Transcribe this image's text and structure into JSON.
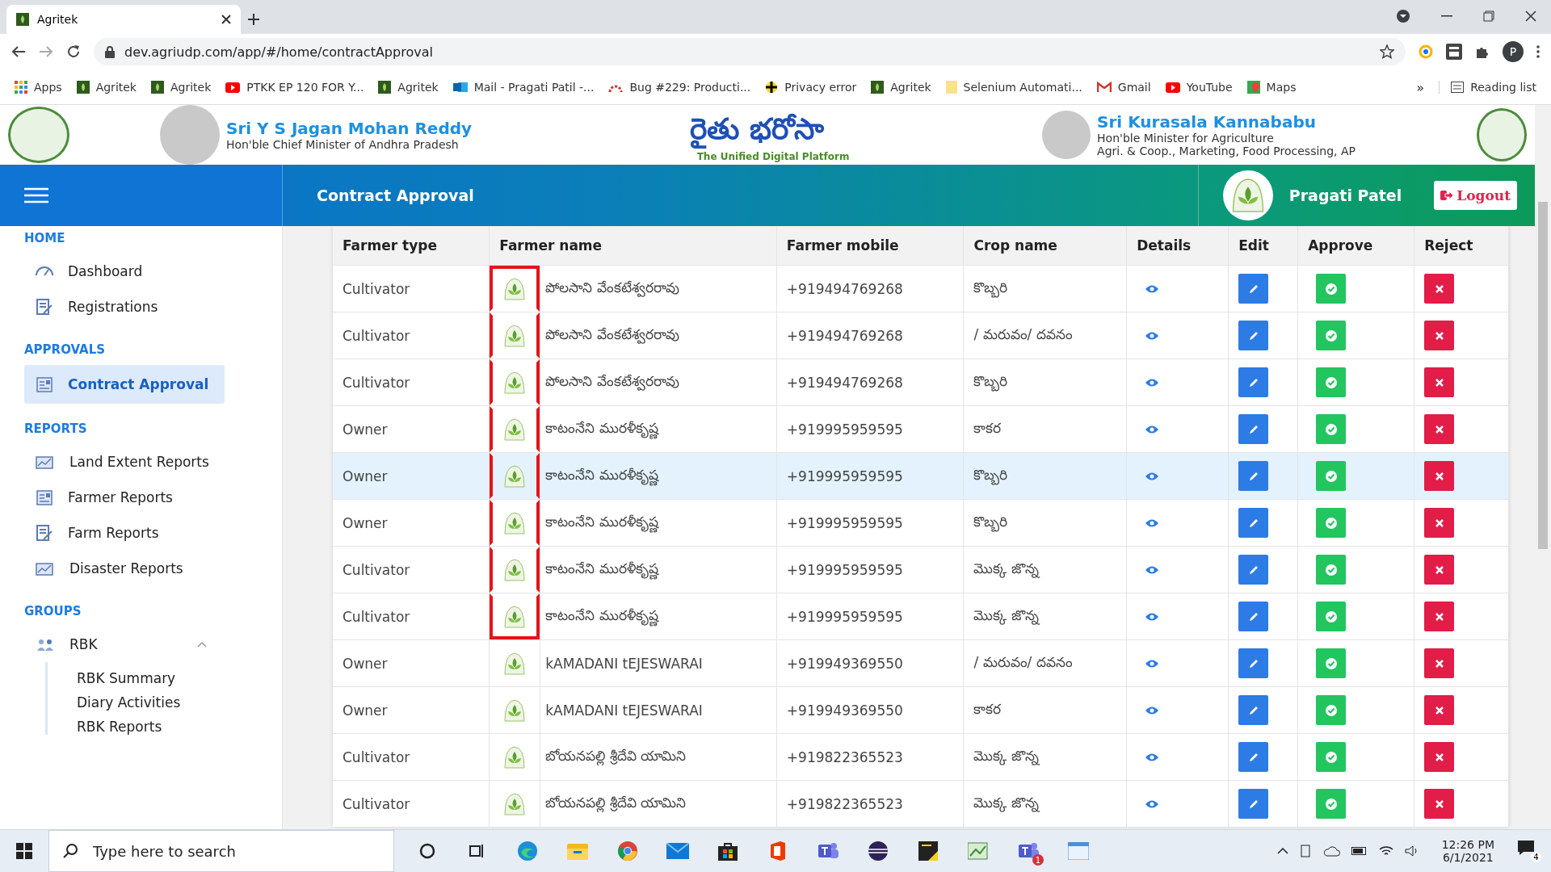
{
  "browser": {
    "tab": {
      "title": "Agritek"
    },
    "url": "dev.agriudp.com/app/#/home/contractApproval",
    "profile": "P",
    "bookmarks": [
      {
        "label": "Apps",
        "kind": "apps"
      },
      {
        "label": "Agritek",
        "kind": "site"
      },
      {
        "label": "Agritek",
        "kind": "site"
      },
      {
        "label": "PTKK EP 120 FOR Y...",
        "kind": "video"
      },
      {
        "label": "Agritek",
        "kind": "site"
      },
      {
        "label": "Mail - Pragati Patil -...",
        "kind": "mail"
      },
      {
        "label": "Bug #229: Producti...",
        "kind": "bug"
      },
      {
        "label": "Privacy error",
        "kind": "warning"
      },
      {
        "label": "Agritek",
        "kind": "site"
      },
      {
        "label": "Selenium Automati...",
        "kind": "folder"
      },
      {
        "label": "Gmail",
        "kind": "gmail"
      },
      {
        "label": "YouTube",
        "kind": "video"
      },
      {
        "label": "Maps",
        "kind": "maps"
      }
    ],
    "more": "»",
    "reading_list": "Reading list"
  },
  "header": {
    "left_name": "Sri Y S Jagan Mohan Reddy",
    "left_role": "Hon'ble Chief Minister of Andhra Pradesh",
    "logo_text": "రైతు భరోసా",
    "logo_tagline": "The Unified Digital Platform",
    "right_name": "Sri Kurasala Kannababu",
    "right_role": "Hon'ble Minister for Agriculture",
    "right_dept": "Agri. & Coop., Marketing, Food Processing, AP"
  },
  "topbar": {
    "title": "Contract Approval",
    "user": "Pragati Patel",
    "logout": "Logout"
  },
  "sidebar": {
    "sections": [
      {
        "title": "HOME",
        "items": [
          {
            "label": "Dashboard",
            "kind": "gauge",
            "selected": false
          },
          {
            "label": "Registrations",
            "kind": "form",
            "selected": false
          }
        ]
      },
      {
        "title": "APPROVALS",
        "items": [
          {
            "label": "Contract Approval",
            "kind": "doc",
            "selected": true
          }
        ]
      },
      {
        "title": "REPORTS",
        "items": [
          {
            "label": "Land Extent Reports",
            "kind": "land",
            "selected": false
          },
          {
            "label": "Farmer Reports",
            "kind": "doc",
            "selected": false
          },
          {
            "label": "Farm Reports",
            "kind": "form",
            "selected": false
          },
          {
            "label": "Disaster Reports",
            "kind": "land",
            "selected": false
          }
        ]
      },
      {
        "title": "GROUPS",
        "items": [
          {
            "label": "RBK",
            "kind": "group",
            "selected": false,
            "expanded": true,
            "children": [
              {
                "label": "RBK Summary"
              },
              {
                "label": "Diary Activities"
              },
              {
                "label": "RBK Reports"
              }
            ]
          }
        ]
      }
    ]
  },
  "table": {
    "columns": [
      "Farmer type",
      "Farmer name",
      "Farmer mobile",
      "Crop name",
      "Details",
      "Edit",
      "Approve",
      "Reject"
    ],
    "rows": [
      {
        "farmer_type": "Cultivator",
        "farmer_name": "పోలసాని వేంకటేశ్వరరావు",
        "farmer_mobile": "+919494769268",
        "crop_name": "కొబ్బరి",
        "selected": false,
        "highlighted": true
      },
      {
        "farmer_type": "Cultivator",
        "farmer_name": "పోలసాని వేంకటేశ్వరరావు",
        "farmer_mobile": "+919494769268",
        "crop_name": "/ మరువం/ దవనం",
        "selected": false,
        "highlighted": true
      },
      {
        "farmer_type": "Cultivator",
        "farmer_name": "పోలసాని వేంకటేశ్వరరావు",
        "farmer_mobile": "+919494769268",
        "crop_name": "కొబ్బరి",
        "selected": false,
        "highlighted": true
      },
      {
        "farmer_type": "Owner",
        "farmer_name": "కాటంనేని మురళీకృష్ణ",
        "farmer_mobile": "+919995959595",
        "crop_name": "కాకర",
        "selected": false,
        "highlighted": true
      },
      {
        "farmer_type": "Owner",
        "farmer_name": "కాటంనేని మురళీకృష్ణ",
        "farmer_mobile": "+919995959595",
        "crop_name": "కొబ్బరి",
        "selected": true,
        "highlighted": true
      },
      {
        "farmer_type": "Owner",
        "farmer_name": "కాటంనేని మురళీకృష్ణ",
        "farmer_mobile": "+919995959595",
        "crop_name": "కొబ్బరి",
        "selected": false,
        "highlighted": true
      },
      {
        "farmer_type": "Cultivator",
        "farmer_name": "కాటంనేని మురళీకృష్ణ",
        "farmer_mobile": "+919995959595",
        "crop_name": "మొక్క జొన్న",
        "selected": false,
        "highlighted": true
      },
      {
        "farmer_type": "Cultivator",
        "farmer_name": "కాటంనేని మురళీకృష్ణ",
        "farmer_mobile": "+919995959595",
        "crop_name": "మొక్క జొన్న",
        "selected": false,
        "highlighted": true
      },
      {
        "farmer_type": "Owner",
        "farmer_name": "kAMADANI tEJESWARAI",
        "farmer_mobile": "+919949369550",
        "crop_name": "/ మరువం/ దవనం",
        "selected": false,
        "highlighted": false
      },
      {
        "farmer_type": "Owner",
        "farmer_name": "kAMADANI tEJESWARAI",
        "farmer_mobile": "+919949369550",
        "crop_name": "కాకర",
        "selected": false,
        "highlighted": false
      },
      {
        "farmer_type": "Cultivator",
        "farmer_name": "బోయనపల్లి శ్రీదేవి యామిని",
        "farmer_mobile": "+919822365523",
        "crop_name": "మొక్క జొన్న",
        "selected": false,
        "highlighted": false
      },
      {
        "farmer_type": "Cultivator",
        "farmer_name": "బోయనపల్లి శ్రీదేవి యామిని",
        "farmer_mobile": "+919822365523",
        "crop_name": "మొక్క జొన్న",
        "selected": false,
        "highlighted": false
      }
    ]
  },
  "taskbar": {
    "search_placeholder": "Type here to search",
    "apps": [
      {
        "kind": "cortana"
      },
      {
        "kind": "taskview"
      },
      {
        "kind": "edge"
      },
      {
        "kind": "explorer"
      },
      {
        "kind": "chrome"
      },
      {
        "kind": "mail"
      },
      {
        "kind": "store"
      },
      {
        "kind": "office"
      },
      {
        "kind": "teams"
      },
      {
        "kind": "eclipse"
      },
      {
        "kind": "notes"
      },
      {
        "kind": "paint"
      },
      {
        "kind": "teams",
        "badge": "1"
      },
      {
        "kind": "window"
      }
    ],
    "time": "12:26 PM",
    "date": "6/1/2021",
    "notifications": "4"
  }
}
